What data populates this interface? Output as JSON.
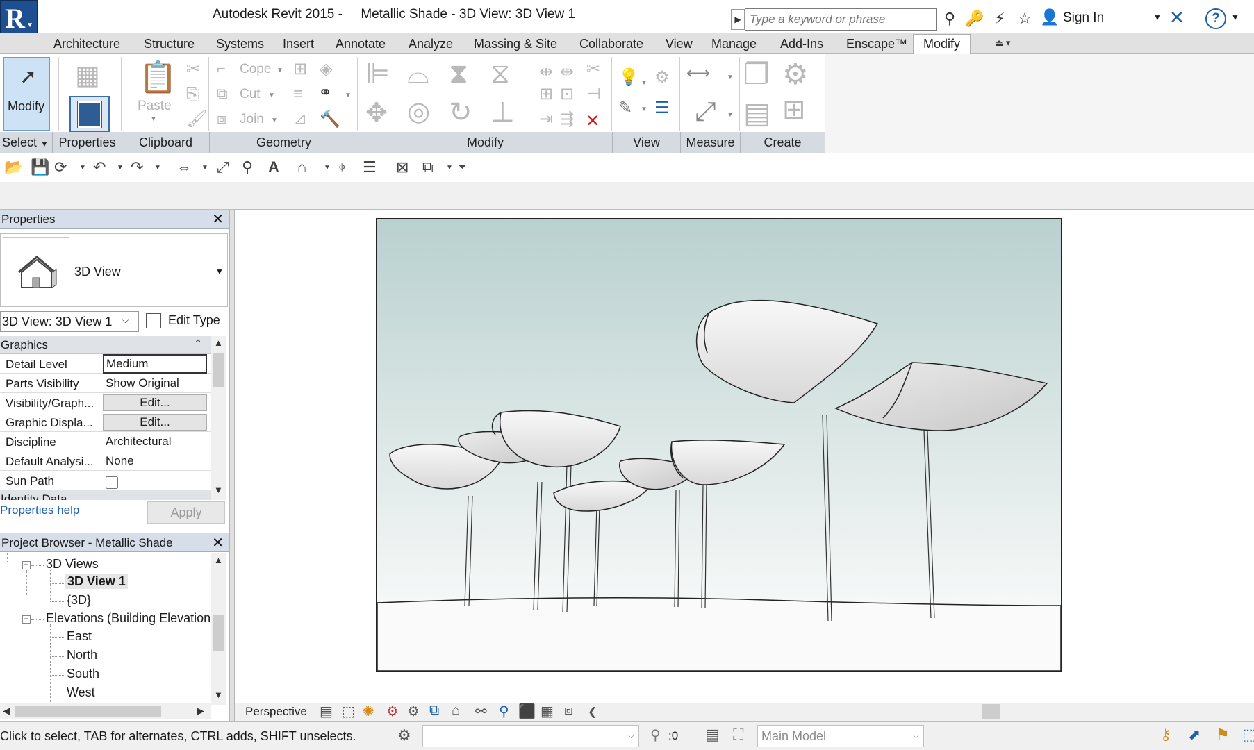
{
  "app": {
    "title": "Autodesk Revit 2015 -     Metallic Shade - 3D View: 3D View 1",
    "logo_letter": "R"
  },
  "search": {
    "placeholder": "Type a keyword or phrase"
  },
  "account": {
    "sign_in_label": "Sign In"
  },
  "ribbon": {
    "tabs": [
      "Architecture",
      "Structure",
      "Systems",
      "Insert",
      "Annotate",
      "Analyze",
      "Massing & Site",
      "Collaborate",
      "View",
      "Manage",
      "Add-Ins",
      "Enscape™",
      "Modify"
    ],
    "active_tab": "Modify",
    "modify_label": "Modify",
    "paste_label": "Paste",
    "cope_label": "Cope",
    "cut_label": "Cut",
    "join_label": "Join",
    "panels": [
      "Select",
      "Properties",
      "Clipboard",
      "Geometry",
      "Modify",
      "View",
      "Measure",
      "Create"
    ]
  },
  "properties": {
    "title": "Properties",
    "type_name": "3D View",
    "view_selector": "3D View: 3D View 1",
    "edit_type_label": "Edit Type",
    "group_graphics": "Graphics",
    "rows": [
      {
        "key": "Detail Level",
        "value": "Medium"
      },
      {
        "key": "Parts Visibility",
        "value": "Show Original"
      },
      {
        "key": "Visibility/Graph...",
        "value": "Edit..."
      },
      {
        "key": "Graphic Displa...",
        "value": "Edit..."
      },
      {
        "key": "Discipline",
        "value": "Architectural"
      },
      {
        "key": "Default Analysi...",
        "value": "None"
      },
      {
        "key": "Sun Path",
        "value": ""
      }
    ],
    "sun_path_checked": false,
    "group_identity": "Identity Data",
    "help_link": "Properties help",
    "apply_label": "Apply"
  },
  "project_browser": {
    "title": "Project Browser - Metallic Shade",
    "nodes": [
      "3D Views",
      "3D View 1",
      "{3D}",
      "Elevations (Building Elevation",
      "East",
      "North",
      "South",
      "West"
    ],
    "selected": "3D View 1"
  },
  "view_control": {
    "scale_label": "Perspective"
  },
  "status_bar": {
    "message": "Click to select, TAB for alternates, CTRL adds, SHIFT unselects.",
    "filter_count": ":0",
    "model_label": "Main Model"
  },
  "colors": {
    "ribbon_label_bar": "#d6dae1",
    "palette_header": "#d5dee9",
    "viewport_sky_top": "#b9d1cf",
    "link": "#1a5fb4",
    "delete_red": "#dd1111"
  }
}
